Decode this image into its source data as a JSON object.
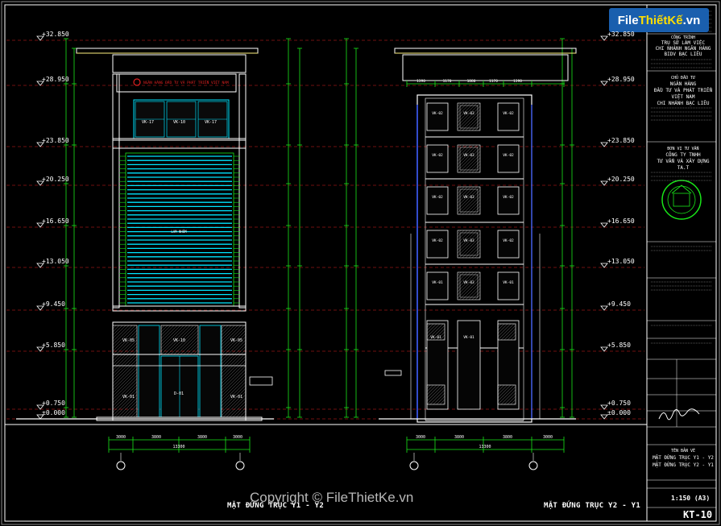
{
  "logo": {
    "text_a": "File",
    "text_b": "ThiếtKế",
    "text_c": ".vn"
  },
  "watermark": "Copyright © FileThietKe.vn",
  "levels": [
    "+32.850",
    "+28.950",
    "+23.850",
    "+20.250",
    "+16.650",
    "+13.050",
    "+9.450",
    "+5.850",
    "+0.750",
    "±0.000"
  ],
  "left_elevation": {
    "title": "MẶT ĐỨNG TRỤC Y1 - Y2",
    "sign_text": "NGÂN HÀNG ĐẦU TƯ VÀ PHÁT TRIỂN VIỆT NAM",
    "facade_label": "LAM NHÔM",
    "window_tags": [
      "VK-17",
      "VK-10",
      "VK-17",
      "VK-05",
      "VK-10",
      "VK-05",
      "VK-01",
      "D-01",
      "VK-01"
    ],
    "bottom_dims": [
      "3000",
      "3800",
      "3000",
      "13300"
    ]
  },
  "right_elevation": {
    "title": "MẶT ĐỨNG TRỤC Y2 - Y1",
    "top_dims": [
      "1390",
      "1170",
      "1880",
      "1170",
      "1390"
    ],
    "window_tags": [
      "VK-02",
      "VK-03",
      "VK-02",
      "VK-02",
      "VK-03",
      "VK-02",
      "VK-02",
      "VK-03",
      "VK-02",
      "VK-02",
      "VK-03",
      "VK-02",
      "VK-01",
      "VK-03",
      "VK-01",
      "VK-01",
      "VK-01"
    ],
    "bottom_dims": [
      "3000",
      "3800",
      "3000",
      "13300"
    ]
  },
  "axes": [
    "Y1",
    "Y2"
  ],
  "title_block": {
    "project_label": "CÔNG TRÌNH",
    "project": [
      "TRỤ SỞ LÀM VIỆC",
      "CHI NHÁNH NGÂN HÀNG",
      "BIDV BẠC LIÊU"
    ],
    "client_label": "CHỦ ĐẦU TƯ",
    "client": [
      "NGÂN HÀNG",
      "ĐẦU TƯ VÀ PHÁT TRIỂN",
      "VIỆT NAM",
      "CHI NHÁNH BẠC LIÊU"
    ],
    "consultant_label": "ĐƠN VỊ TƯ VẤN",
    "consultant": [
      "CÔNG TY TNHH",
      "TƯ VẤN VÀ XÂY DỰNG",
      "TA.T"
    ],
    "drawing_label": "TÊN BẢN VẼ",
    "drawing": [
      "MẶT ĐỨNG TRỤC Y1 - Y2",
      "MẶT ĐỨNG TRỤC Y2 - Y1"
    ],
    "scale": "1:150 (A3)",
    "sheet": "KT-10"
  },
  "colors": {
    "cyan": "#00e5ff",
    "green": "#19e619",
    "red": "#e02020",
    "blue": "#3355ff",
    "yellow": "#ffe600",
    "grey": "#8c8c8c",
    "white": "#ffffff",
    "magenta": "#ff44ff"
  }
}
